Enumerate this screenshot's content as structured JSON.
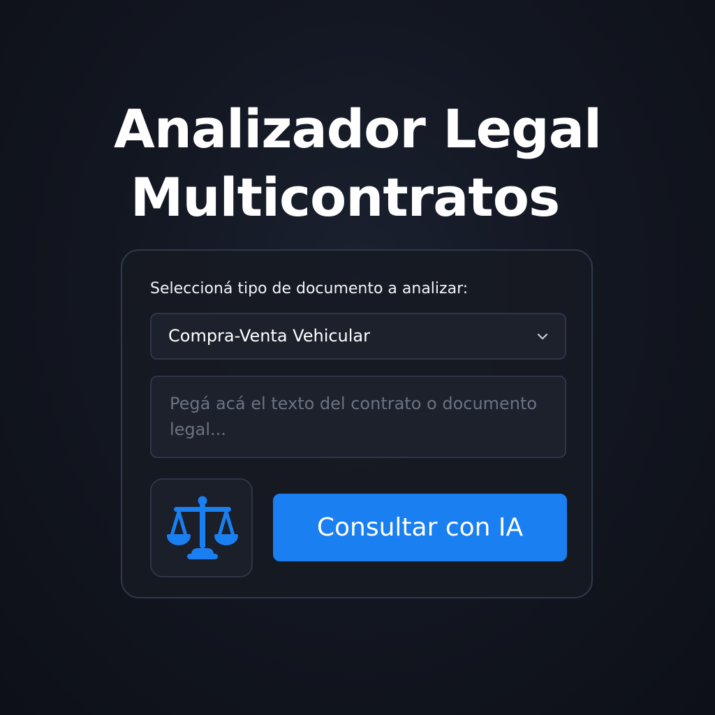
{
  "header": {
    "title_line1": "Analizador Legal",
    "title_line2": "Multicontratos"
  },
  "form": {
    "label": "Seleccioná tipo de documento a analizar:",
    "document_type": {
      "selected": "Compra-Venta Vehicular",
      "icon": "chevron-down-icon"
    },
    "contract_text": {
      "value": "",
      "placeholder": "Pegá acá el texto del contrato o documento legal..."
    },
    "badge_icon": "scale-balance-icon",
    "submit_label": "Consultar con IA"
  },
  "colors": {
    "accent": "#1a7ff0",
    "background": "#131722",
    "card_border": "#30384a",
    "placeholder": "#6b7382"
  }
}
